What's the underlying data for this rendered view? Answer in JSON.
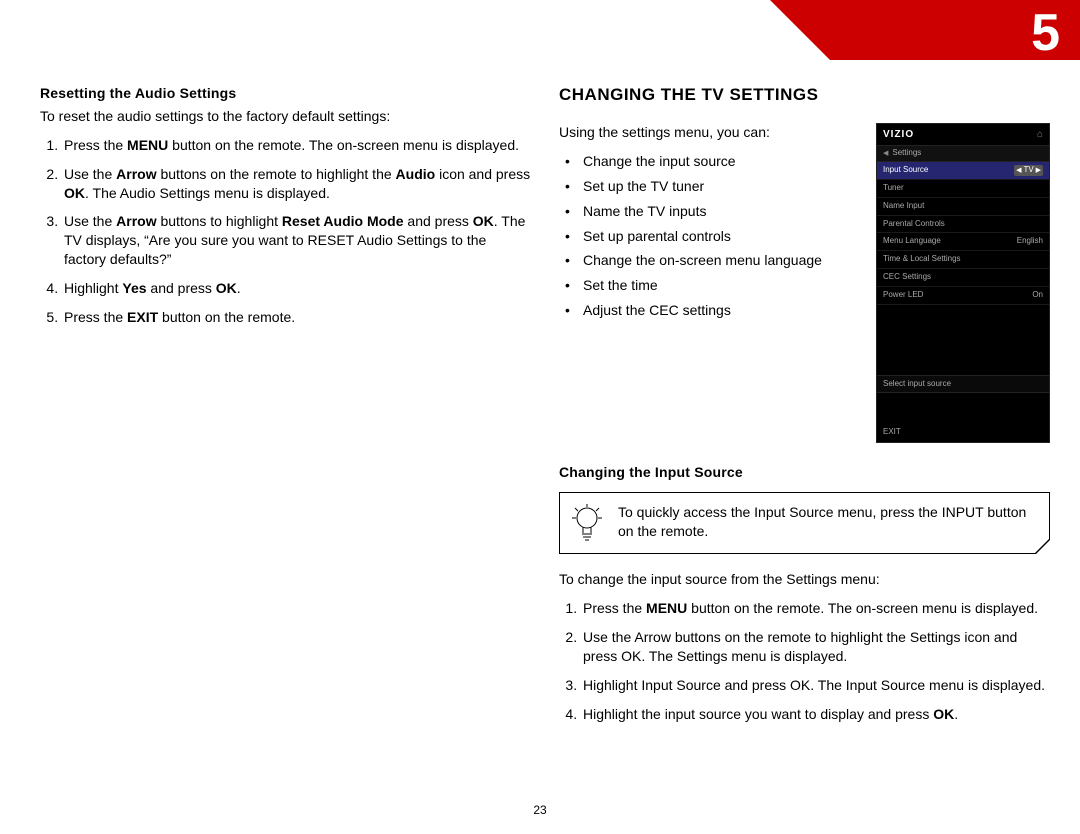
{
  "chapter": "5",
  "page_number": "23",
  "left": {
    "heading": "Resetting the Audio Settings",
    "intro": "To reset the audio settings to the factory default settings:",
    "steps": {
      "s1a": "Press the ",
      "s1b": "MENU",
      "s1c": " button on the remote. The on-screen menu is displayed.",
      "s2a": "Use the ",
      "s2b": "Arrow",
      "s2c": " buttons on the remote to highlight the ",
      "s2d": "Audio",
      "s2e": " icon and press ",
      "s2f": "OK",
      "s2g": ". The Audio Settings menu is displayed.",
      "s3a": "Use the ",
      "s3b": "Arrow",
      "s3c": " buttons to highlight ",
      "s3d": "Reset Audio Mode",
      "s3e": " and press ",
      "s3f": "OK",
      "s3g": ". The TV displays, “Are you sure you want to RESET Audio Settings to the factory defaults?”",
      "s4a": "Highlight ",
      "s4b": "Yes",
      "s4c": " and press ",
      "s4d": "OK",
      "s4e": ".",
      "s5a": "Press the ",
      "s5b": "EXIT",
      "s5c": " button on the remote."
    }
  },
  "right": {
    "title": "CHANGING THE TV SETTINGS",
    "intro": "Using the settings menu, you can:",
    "bullets": {
      "b1": "Change the input source",
      "b2": "Set up the TV tuner",
      "b3": "Name the TV inputs",
      "b4": "Set up parental controls",
      "b5": "Change the on-screen menu language",
      "b6": "Set the time",
      "b7": "Adjust the CEC settings"
    },
    "sub_heading": "Changing the Input Source",
    "tip": "To quickly access the Input Source menu, press the INPUT button on the remote.",
    "intro2": "To change the input source from the Settings menu:",
    "steps2": {
      "t1a": "Press the ",
      "t1b": "MENU",
      "t1c": " button on the remote. The on-screen menu is displayed.",
      "t2": "Use the Arrow buttons on the remote to highlight the Settings icon and press OK. The Settings menu is displayed.",
      "t3": "Highlight Input Source and press OK. The Input Source menu is displayed.",
      "t4a": "Highlight the input source you want to display and press ",
      "t4b": "OK",
      "t4c": "."
    }
  },
  "osd": {
    "brand": "VIZIO",
    "menu": "Settings",
    "rows": {
      "r1l": "Input Source",
      "r1r": "TV",
      "r2l": "Tuner",
      "r3l": "Name Input",
      "r4l": "Parental Controls",
      "r5l": "Menu Language",
      "r5r": "English",
      "r6l": "Time & Local Settings",
      "r7l": "CEC Settings",
      "r8l": "Power LED",
      "r8r": "On"
    },
    "hint": "Select input source",
    "exit": "EXIT"
  }
}
